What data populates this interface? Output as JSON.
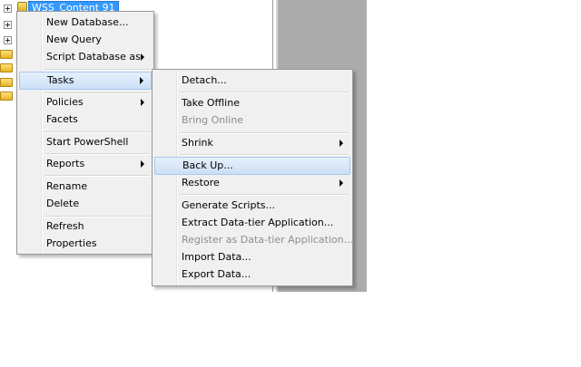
{
  "tree": {
    "selected_node": "WSS_Content 91"
  },
  "context_menu": {
    "items": [
      {
        "label": "New Database...",
        "arrow": false
      },
      {
        "label": "New Query",
        "arrow": false
      },
      {
        "label": "Script Database as",
        "arrow": true
      },
      {
        "label": "Tasks",
        "arrow": true
      },
      {
        "label": "Policies",
        "arrow": true
      },
      {
        "label": "Facets",
        "arrow": false
      },
      {
        "label": "Start PowerShell",
        "arrow": false
      },
      {
        "label": "Reports",
        "arrow": true
      },
      {
        "label": "Rename",
        "arrow": false
      },
      {
        "label": "Delete",
        "arrow": false
      },
      {
        "label": "Refresh",
        "arrow": false
      },
      {
        "label": "Properties",
        "arrow": false
      }
    ]
  },
  "tasks_submenu": {
    "items": [
      {
        "label": "Detach...",
        "disabled": false
      },
      {
        "label": "Take Offline",
        "disabled": false
      },
      {
        "label": "Bring Online",
        "disabled": true
      },
      {
        "label": "Shrink",
        "disabled": false,
        "arrow": true
      },
      {
        "label": "Back Up...",
        "disabled": false
      },
      {
        "label": "Restore",
        "disabled": false,
        "arrow": true
      },
      {
        "label": "Generate Scripts...",
        "disabled": false
      },
      {
        "label": "Extract Data-tier Application...",
        "disabled": false
      },
      {
        "label": "Register as Data-tier Application...",
        "disabled": true
      },
      {
        "label": "Import Data...",
        "disabled": false
      },
      {
        "label": "Export Data...",
        "disabled": false
      }
    ]
  },
  "colors": {
    "selection": "#3399ff",
    "highlight": "#cbe0f7",
    "menu_bg": "#f0f0f0",
    "panel_gray": "#ababab"
  }
}
